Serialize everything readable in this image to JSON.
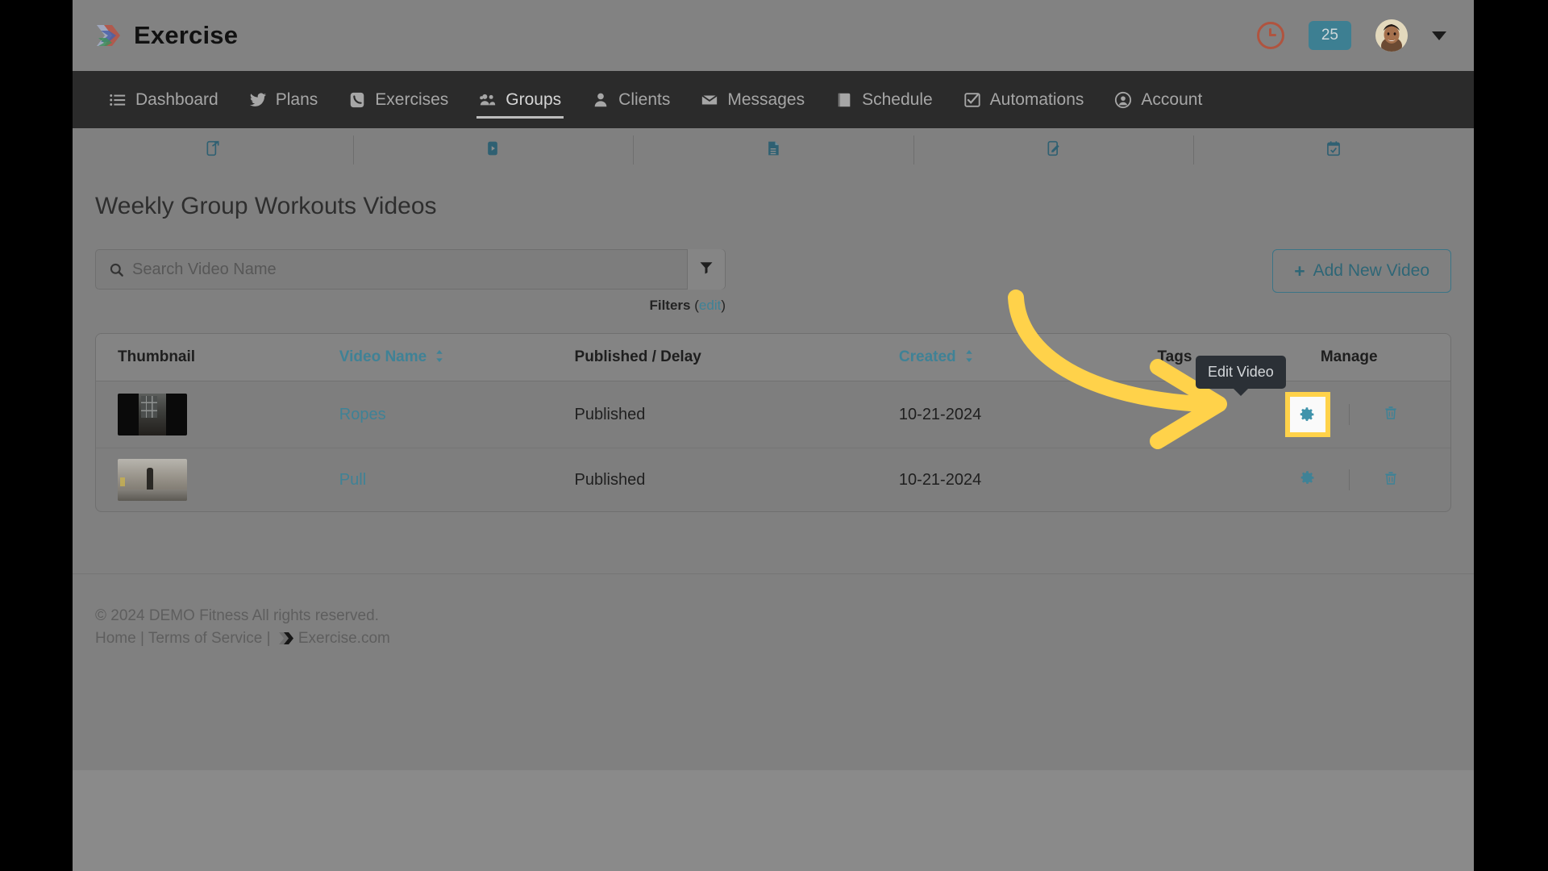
{
  "header": {
    "brand": "Exercise",
    "brand_logo_icon": "exercise-chevrons-logo",
    "clock_icon": "clock-icon",
    "notification_count": "25",
    "avatar_icon": "user-avatar",
    "chevron_icon": "chevron-down-icon"
  },
  "nav": {
    "items": [
      {
        "label": "Dashboard",
        "icon": "list-icon",
        "active": false
      },
      {
        "label": "Plans",
        "icon": "twitter-bird-icon",
        "active": false
      },
      {
        "label": "Exercises",
        "icon": "phone-icon",
        "active": false
      },
      {
        "label": "Groups",
        "icon": "users-group-icon",
        "active": true
      },
      {
        "label": "Clients",
        "icon": "user-icon",
        "active": false
      },
      {
        "label": "Messages",
        "icon": "envelope-icon",
        "active": false
      },
      {
        "label": "Schedule",
        "icon": "book-icon",
        "active": false
      },
      {
        "label": "Automations",
        "icon": "check-square-icon",
        "active": false
      },
      {
        "label": "Account",
        "icon": "user-circle-icon",
        "active": false
      }
    ]
  },
  "subnav": {
    "items": [
      {
        "icon": "external-link-mobile-icon"
      },
      {
        "icon": "video-play-icon"
      },
      {
        "icon": "document-icon"
      },
      {
        "icon": "edit-pencil-icon"
      },
      {
        "icon": "calendar-check-icon"
      }
    ]
  },
  "main": {
    "page_title": "Weekly Group Workouts Videos",
    "search": {
      "placeholder": "Search Video Name",
      "value": "",
      "icon": "search-icon",
      "filter_button_icon": "funnel-filter-icon"
    },
    "filters_label": "Filters",
    "filters_edit_label": "edit",
    "filters_open_paren": "(",
    "filters_close_paren": ")",
    "add_button": {
      "label": "Add New Video",
      "plus": "+"
    }
  },
  "table": {
    "columns": [
      {
        "label": "Thumbnail",
        "sortable": false
      },
      {
        "label": "Video Name",
        "sortable": true
      },
      {
        "label": "Published / Delay",
        "sortable": false
      },
      {
        "label": "Created",
        "sortable": true
      },
      {
        "label": "Tags",
        "sortable": false
      },
      {
        "label": "Manage",
        "sortable": false
      }
    ],
    "rows": [
      {
        "thumbnail_alt": "ropes-video-thumbnail",
        "name": "Ropes",
        "published": "Published",
        "created": "10-21-2024",
        "tags": "",
        "edit_icon": "gear-icon",
        "delete_icon": "trash-icon"
      },
      {
        "thumbnail_alt": "pull-video-thumbnail",
        "name": "Pull",
        "published": "Published",
        "created": "10-21-2024",
        "tags": "",
        "edit_icon": "gear-icon",
        "delete_icon": "trash-icon"
      }
    ]
  },
  "tooltip": {
    "text": "Edit Video"
  },
  "annotation": {
    "arrow_color": "#ffd24a",
    "highlight_color": "#ffd24a"
  },
  "footer": {
    "copyright": "© 2024 DEMO Fitness All rights reserved.",
    "links": [
      "Home",
      "Terms of Service"
    ],
    "separator": "|",
    "site_name": "Exercise.com",
    "site_logo_icon": "exercise-chevrons-logo"
  },
  "colors": {
    "accent_teal": "#3f8296",
    "nav_dark": "#2b2b2b",
    "header_gray": "#828282",
    "highlight_yellow": "#ffd24a",
    "clock_red": "#b0543f",
    "badge_teal": "#3d7f92"
  }
}
